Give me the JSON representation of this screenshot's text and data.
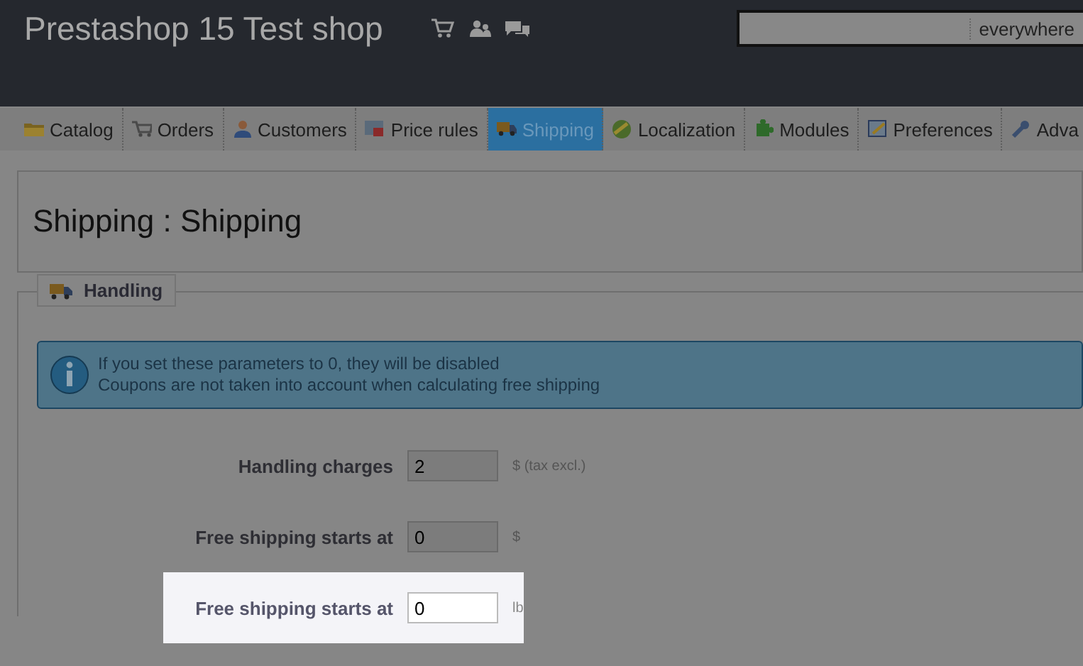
{
  "header": {
    "shop_title": "Prestashop 15 Test shop",
    "search": {
      "scope": "everywhere"
    }
  },
  "tabs": [
    {
      "label": "Catalog",
      "selected": false
    },
    {
      "label": "Orders",
      "selected": false
    },
    {
      "label": "Customers",
      "selected": false
    },
    {
      "label": "Price rules",
      "selected": false
    },
    {
      "label": "Shipping",
      "selected": true
    },
    {
      "label": "Localization",
      "selected": false
    },
    {
      "label": "Modules",
      "selected": false
    },
    {
      "label": "Preferences",
      "selected": false
    },
    {
      "label": "Adva",
      "selected": false
    }
  ],
  "page_title": "Shipping : Shipping",
  "fieldset": {
    "legend": "Handling",
    "info": [
      "If you set these parameters to 0, they will be disabled",
      "Coupons are not taken into account when calculating free shipping"
    ],
    "rows": [
      {
        "label": "Handling charges",
        "value": "2",
        "unit": "$ (tax excl.)",
        "highlighted": false
      },
      {
        "label": "Free shipping starts at",
        "value": "0",
        "unit": "$",
        "highlighted": false
      },
      {
        "label": "Free shipping starts at",
        "value": "0",
        "unit": "lb",
        "highlighted": true
      }
    ]
  }
}
